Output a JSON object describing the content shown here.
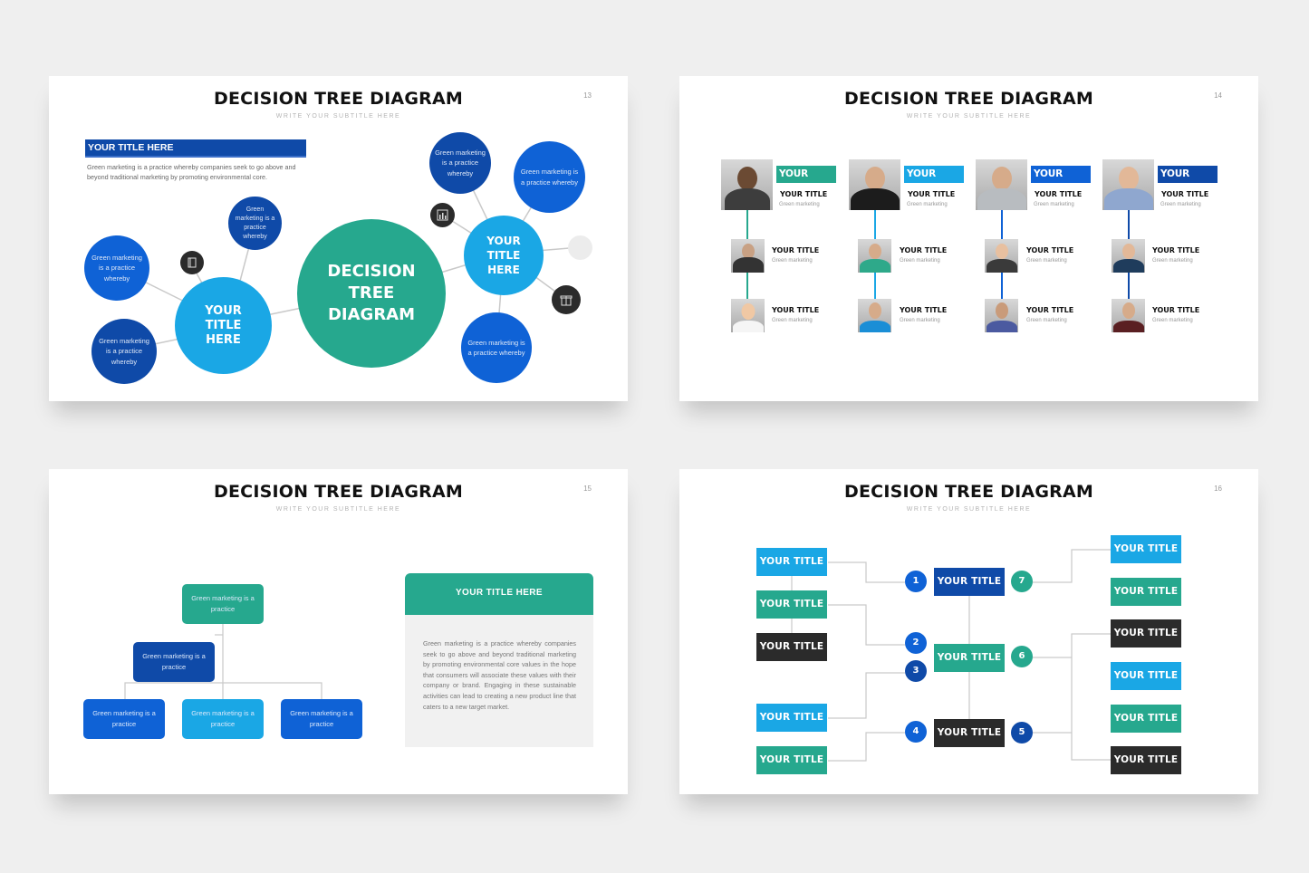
{
  "colors": {
    "background": "#efefef",
    "teal": "#26a88e",
    "sky": "#1aa7e5",
    "blue": "#0f62d6",
    "navy": "#0f4aa8",
    "dark": "#2b2b2b",
    "connector": "#c8c8c8"
  },
  "slides": [
    {
      "number": "13",
      "title": "DECISION TREE DIAGRAM",
      "subtitle": "WRITE YOUR SUBTITLE HERE",
      "header_bar": "YOUR TITLE HERE",
      "lead_text": "Green marketing is a practice whereby companies seek to go above and beyond traditional marketing by promoting environmental core.",
      "center": "DECISION TREE DIAGRAM",
      "hubs": [
        "YOUR TITLE HERE",
        "YOUR TITLE HERE"
      ],
      "leaves": [
        "Green marketing is a practice whereby",
        "Green marketing is a practice whereby",
        "Green marketing is a practice whereby",
        "Green marketing is a practice whereby",
        "Green marketing is a practice whereby",
        "Green marketing is a practice whereby"
      ],
      "icons": [
        "book-icon",
        "chart-report-icon",
        "placeholder-icon",
        "gift-box-icon"
      ]
    },
    {
      "number": "14",
      "title": "DECISION TREE DIAGRAM",
      "subtitle": "WRITE YOUR SUBTITLE HERE",
      "columns": [
        {
          "tag": "YOUR TITLE",
          "name": "YOUR TITLE",
          "desc": "Green marketing",
          "members": [
            {
              "name": "YOUR TITLE",
              "desc": "Green marketing"
            },
            {
              "name": "YOUR TITLE",
              "desc": "Green marketing"
            }
          ]
        },
        {
          "tag": "YOUR TITLE",
          "name": "YOUR TITLE",
          "desc": "Green marketing",
          "members": [
            {
              "name": "YOUR TITLE",
              "desc": "Green marketing"
            },
            {
              "name": "YOUR TITLE",
              "desc": "Green marketing"
            }
          ]
        },
        {
          "tag": "YOUR TITLE",
          "name": "YOUR TITLE",
          "desc": "Green marketing",
          "members": [
            {
              "name": "YOUR TITLE",
              "desc": "Green marketing"
            },
            {
              "name": "YOUR TITLE",
              "desc": "Green marketing"
            }
          ]
        },
        {
          "tag": "YOUR TITLE",
          "name": "YOUR TITLE",
          "desc": "Green marketing",
          "members": [
            {
              "name": "YOUR TITLE",
              "desc": "Green marketing"
            },
            {
              "name": "YOUR TITLE",
              "desc": "Green marketing"
            }
          ]
        }
      ]
    },
    {
      "number": "15",
      "title": "DECISION TREE DIAGRAM",
      "subtitle": "WRITE YOUR SUBTITLE HERE",
      "nodes": [
        "Green marketing is a practice",
        "Green marketing is a practice",
        "Green marketing is a practice",
        "Green marketing is a practice",
        "Green marketing is a practice"
      ],
      "card_title": "YOUR TITLE HERE",
      "card_text": "Green marketing is a practice whereby companies seek to go above and beyond traditional marketing by promoting environmental core values in the hope that consumers will associate these values with their company or brand. Engaging in these sustainable activities can lead to creating a new product line that caters to a new target market."
    },
    {
      "number": "16",
      "title": "DECISION TREE DIAGRAM",
      "subtitle": "WRITE YOUR SUBTITLE HERE",
      "left_boxes": [
        "YOUR TITLE",
        "YOUR TITLE",
        "YOUR TITLE",
        "YOUR TITLE",
        "YOUR TITLE"
      ],
      "center_boxes": [
        "YOUR TITLE",
        "YOUR TITLE",
        "YOUR TITLE"
      ],
      "right_boxes": [
        "YOUR TITLE",
        "YOUR TITLE",
        "YOUR TITLE",
        "YOUR TITLE",
        "YOUR TITLE",
        "YOUR TITLE"
      ],
      "steps": [
        "1",
        "2",
        "3",
        "4",
        "5",
        "6",
        "7"
      ]
    }
  ]
}
